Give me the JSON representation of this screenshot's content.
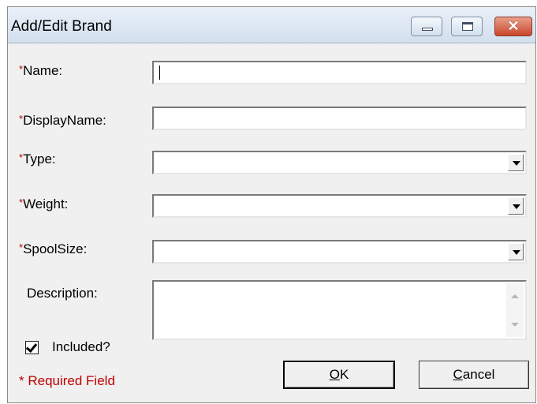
{
  "window": {
    "title": "Add/Edit Brand",
    "close_glyph": "✕"
  },
  "form": {
    "required_marker": "*",
    "fields": [
      {
        "label": "Name:",
        "required": true,
        "value": ""
      },
      {
        "label": "DisplayName:",
        "required": true,
        "value": ""
      },
      {
        "label": "Type:",
        "required": true,
        "value": ""
      },
      {
        "label": "Weight:",
        "required": true,
        "value": ""
      },
      {
        "label": "SpoolSize:",
        "required": true,
        "value": ""
      },
      {
        "label": "Description:",
        "required": false,
        "value": ""
      }
    ],
    "included": {
      "label": "Included?",
      "checked": true
    },
    "required_note": "* Required Field"
  },
  "buttons": {
    "ok_mnemonic": "O",
    "ok_rest": "K",
    "cancel_mnemonic": "C",
    "cancel_rest": "ancel"
  },
  "colors": {
    "required": "#c00000",
    "dialog_bg": "#f0f0f0",
    "close_button": "#c9472b"
  }
}
